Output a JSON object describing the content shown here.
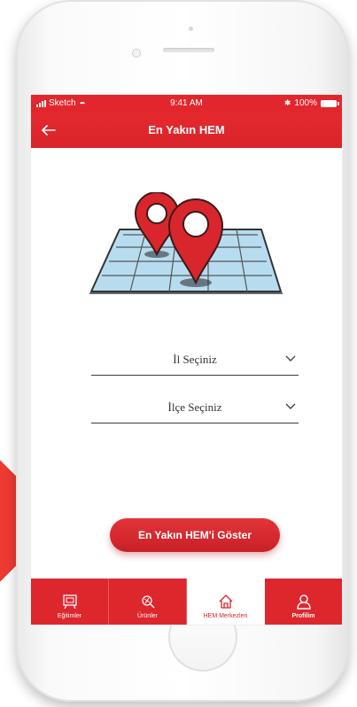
{
  "status_bar": {
    "carrier": "Sketch",
    "time": "9:41 AM",
    "battery": "100%"
  },
  "header": {
    "title": "En Yakın HEM"
  },
  "form": {
    "province_select": "İl Seçiniz",
    "district_select": "İlçe Seçiniz"
  },
  "cta": {
    "label": "En Yakın HEM'i Göster"
  },
  "tabs": [
    {
      "label": "Eğitimler",
      "icon": "training-icon",
      "active": false
    },
    {
      "label": "Ürünler",
      "icon": "products-icon",
      "active": false
    },
    {
      "label": "HEM Merkezleri",
      "icon": "home-icon",
      "active": true
    },
    {
      "label": "Profilim",
      "icon": "profile-icon",
      "active": false
    }
  ],
  "colors": {
    "brand_red": "#e1272d",
    "accent_red": "#ee3b31",
    "map_blue": "#b7dcf0"
  }
}
